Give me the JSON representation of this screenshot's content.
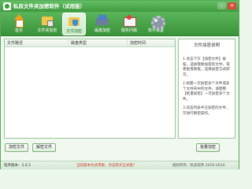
{
  "app": {
    "title": "私房文件夹加密软件（试用版）",
    "accent_color": "#4aa84a"
  },
  "window_controls": {
    "minimize": "–",
    "close": "×"
  },
  "toolbar": {
    "items": [
      {
        "label": "首页",
        "icon": "house-icon",
        "active": false
      },
      {
        "label": "文件夹加密",
        "icon": "folder-lock-icon",
        "active": false
      },
      {
        "label": "文件加密",
        "icon": "folder-shield-icon",
        "active": true
      },
      {
        "label": "磁盘加密",
        "icon": "disk-icon",
        "active": false
      },
      {
        "label": "服务问题",
        "icon": "mail-icon",
        "active": false
      },
      {
        "label": "软件设置",
        "icon": "gear-icon",
        "active": false
      }
    ]
  },
  "file_list": {
    "columns": [
      "文件路径",
      "磁盘类型",
      "加密时间"
    ],
    "rows": []
  },
  "help_panel": {
    "title": "文件加密说明",
    "paragraphs": [
      "1.点击下方【加密文件】按钮，选择需要加密的文件，或者拖曳到框，选择加密方式即可。",
      "2.如需一次加密多个文件或多个文件夹中的文件，请使用【批量加密】一次加密多个文件。",
      "3.双击列表中已加密的文件，可进行解密操作。"
    ]
  },
  "buttons": {
    "encrypt": "加密文件",
    "decrypt": "解密文件",
    "batch": "批量加密"
  },
  "statusbar": {
    "version": "程序版本：2.4.5",
    "notice": "当前版本为试用版，点击购买正式版！",
    "copyright": "版权所有：私房软件 2010-2014"
  }
}
